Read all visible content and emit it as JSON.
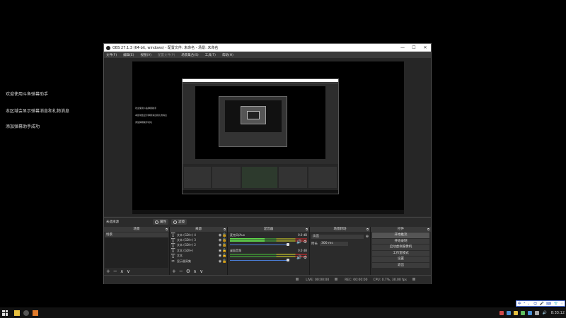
{
  "chat": {
    "lines": [
      "欢迎使用斗鱼弹幕助手",
      "本区域会显示弹幕消息和礼物消息",
      "添加弹幕助手成功"
    ]
  },
  "obs": {
    "title": "OBS 27.1.3 (64-bit, windows) - 配置文件: 未命名 - 场景: 未命名",
    "window_buttons": [
      "—",
      "☐",
      "✕"
    ],
    "menu": [
      {
        "label": "文件(F)",
        "enabled": true
      },
      {
        "label": "编辑(E)",
        "enabled": true
      },
      {
        "label": "视图(V)",
        "enabled": true
      },
      {
        "label": "配置文件(P)",
        "enabled": false
      },
      {
        "label": "场景集合(S)",
        "enabled": true
      },
      {
        "label": "工具(T)",
        "enabled": true
      },
      {
        "label": "帮助(H)",
        "enabled": true
      }
    ],
    "preview_chat_lines": [
      "欢迎使用斗鱼弹幕助手",
      "本区域会显示弹幕消息和礼物消息",
      "添加弹幕助手成功"
    ],
    "scene_bar": {
      "label": "未选择源",
      "props_label": "属性",
      "filters_label": "滤镜"
    },
    "scenes": {
      "title": "场景",
      "items": [
        "场景"
      ],
      "footer": [
        "+",
        "−",
        "∧",
        "∨"
      ]
    },
    "sources": {
      "title": "来源",
      "items": [
        {
          "icon": "T",
          "label": "文本 (GDI+) 4"
        },
        {
          "icon": "T",
          "label": "文本 (GDI+) 3"
        },
        {
          "icon": "T",
          "label": "文本 (GDI+) 2"
        },
        {
          "icon": "T",
          "label": "文本 (GDI+)"
        },
        {
          "icon": "T",
          "label": "文本"
        },
        {
          "icon": "∞",
          "label": "显示器采集"
        }
      ],
      "footer": [
        "+",
        "−",
        "⚙",
        "∧",
        "∨"
      ]
    },
    "mixer": {
      "title": "混音器",
      "channels": [
        {
          "name": "麦克风/Aux",
          "db": "0.0 dB",
          "level": 0.45
        },
        {
          "name": "桌面音频",
          "db": "0.0 dB",
          "level": 0.0
        }
      ]
    },
    "transitions": {
      "title": "场景转场",
      "type": "淡出",
      "duration_label": "时长",
      "duration_value": "300 ms"
    },
    "controls": {
      "title": "控件",
      "buttons": [
        "开始推流",
        "开始录制",
        "启动虚拟摄像机",
        "工作室模式",
        "设置",
        "退出"
      ]
    },
    "status": {
      "live": "LIVE: 00:00:00",
      "rec": "REC: 00:00:00",
      "cpu": "CPU: 0.7%, 30.00 fps"
    }
  },
  "ime": {
    "items": [
      "中",
      "°",
      "，",
      "😊",
      "🎤",
      "⌨",
      "👕",
      "⁘"
    ]
  },
  "taskbar": {
    "clock": "8:33:12",
    "tray_colors": [
      "#d04a4a",
      "#4a90d6",
      "#e6c040",
      "#5fbf5f",
      "#4a90d6",
      "#aaaaaa"
    ]
  }
}
